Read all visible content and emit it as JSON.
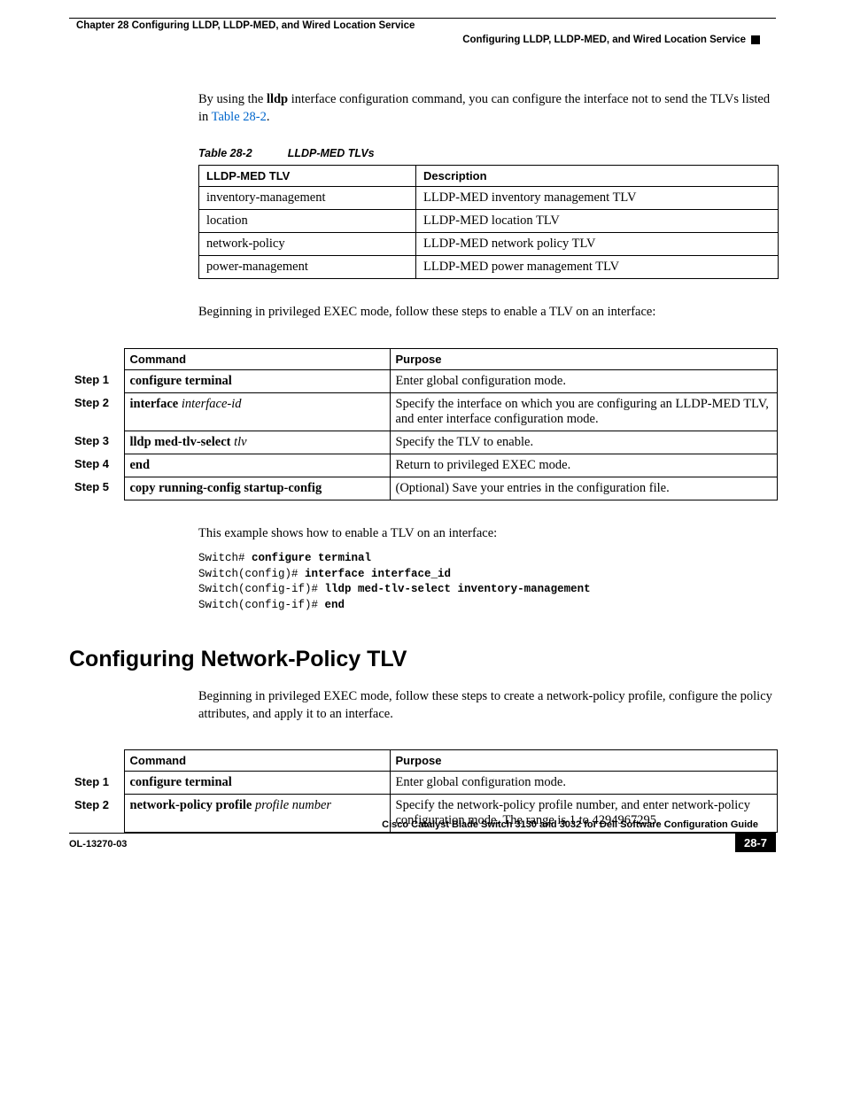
{
  "header": {
    "chapter": "Chapter 28      Configuring LLDP, LLDP-MED, and Wired Location Service",
    "section": "Configuring LLDP, LLDP-MED, and Wired Location Service"
  },
  "intro": {
    "pre": "By using the ",
    "cmd": "lldp",
    "post": " interface configuration command, you can configure the interface not to send the TLVs listed in ",
    "link": "Table 28-2",
    "end": "."
  },
  "table_caption": {
    "num": "Table 28-2",
    "title": "LLDP-MED TLVs"
  },
  "tlv_table": {
    "h1": "LLDP-MED TLV",
    "h2": "Description",
    "rows": [
      {
        "c1": "inventory-management",
        "c2": "LLDP-MED inventory management TLV"
      },
      {
        "c1": "location",
        "c2": "LLDP-MED location TLV"
      },
      {
        "c1": "network-policy",
        "c2": "LLDP-MED network policy TLV"
      },
      {
        "c1": "power-management",
        "c2": "LLDP-MED power management TLV"
      }
    ]
  },
  "para_begin1": "Beginning in privileged EXEC mode, follow these steps to enable a TLV on an interface:",
  "steps1": {
    "h_step": "",
    "h_cmd": "Command",
    "h_purpose": "Purpose",
    "rows": [
      {
        "s": "Step 1",
        "c": "configure terminal",
        "ci": "",
        "p": "Enter global configuration mode."
      },
      {
        "s": "Step 2",
        "c": "interface ",
        "ci": "interface-id",
        "p": "Specify the interface on which you are configuring an LLDP-MED TLV, and enter interface configuration mode."
      },
      {
        "s": "Step 3",
        "c": "lldp med-tlv-select ",
        "ci": "tlv",
        "p": "Specify the TLV to enable."
      },
      {
        "s": "Step 4",
        "c": "end",
        "ci": "",
        "p": "Return to privileged EXEC mode."
      },
      {
        "s": "Step 5",
        "c": "copy running-config startup-config",
        "ci": "",
        "p": "(Optional) Save your entries in the configuration file."
      }
    ]
  },
  "example_intro": "This example shows how to enable a TLV on an interface:",
  "code": {
    "l1a": "Switch# ",
    "l1b": "configure terminal",
    "l2a": "Switch(config)# ",
    "l2b": "interface interface_id",
    "l3a": "Switch(config-if)# ",
    "l3b": "lldp med-tlv-select inventory-management",
    "l4a": "Switch(config-if)# ",
    "l4b": "end"
  },
  "h2": "Configuring Network-Policy TLV",
  "para_begin2": "Beginning in privileged EXEC mode, follow these steps to create a network-policy profile, configure the policy attributes, and apply it to an interface.",
  "steps2": {
    "h_cmd": "Command",
    "h_purpose": "Purpose",
    "rows": [
      {
        "s": "Step 1",
        "c": "configure terminal",
        "ci": "",
        "p": "Enter global configuration mode."
      },
      {
        "s": "Step 2",
        "c": "network-policy profile ",
        "ci": "profile number",
        "p": "Specify the network-policy profile number, and enter network-policy configuration mode. The range is 1 to 4294967295."
      }
    ]
  },
  "footer": {
    "title": "Cisco Catalyst Blade Switch 3130 and 3032 for Dell Software Configuration Guide",
    "doc": "OL-13270-03",
    "page": "28-7"
  }
}
